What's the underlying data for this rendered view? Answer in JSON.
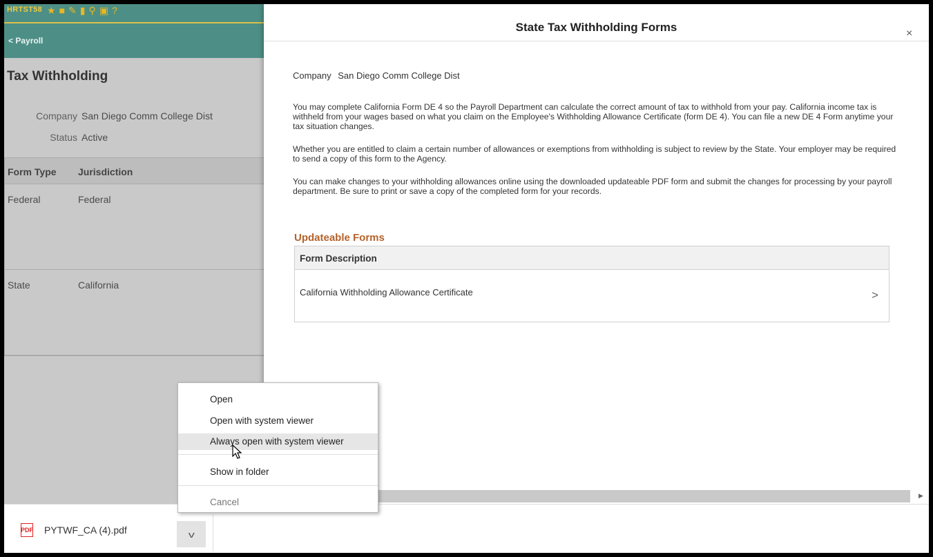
{
  "left_pane": {
    "app_code": "HRTST58",
    "toolbar_icons": [
      "star-icon",
      "folder-icon",
      "pencil-icon",
      "document-icon",
      "search-icon",
      "folder-search-icon",
      "help-icon"
    ],
    "back_label": "< Payroll",
    "title": "Tax Withholding",
    "company_label": "Company",
    "company_value": "San Diego Comm College Dist",
    "status_label": "Status",
    "status_value": "Active",
    "grid": {
      "columns": [
        "Form Type",
        "Jurisdiction"
      ],
      "rows": [
        [
          "Federal",
          "Federal"
        ],
        [
          "State",
          "California"
        ]
      ]
    }
  },
  "modal": {
    "title": "State Tax Withholding Forms",
    "close_label": "×",
    "company_label": "Company",
    "company_value": "San Diego Comm College Dist",
    "paragraphs": [
      "You may complete California Form DE 4 so the Payroll Department can calculate the correct amount of tax to withhold from your pay.  California income tax is withheld from your wages based on what you claim on the Employee's Withholding Allowance Certificate (form DE 4).  You can file a new DE 4 Form anytime your tax situation changes.",
      "Whether you are entitled to claim a certain number of allowances or exemptions from withholding is subject to review by the State. Your employer may be required to send a copy of this form to the Agency.",
      "You can make changes to your withholding allowances online using the downloaded updateable PDF form and submit the changes for processing by your payroll department.  Be sure to print or save a copy of the completed form for your records."
    ],
    "updateable_forms": {
      "title": "Updateable Forms",
      "header": "Form Description",
      "rows": [
        "California Withholding Allowance Certificate"
      ],
      "chevron": ">"
    }
  },
  "download_bar": {
    "filename": "PYTWF_CA (4).pdf",
    "pdf_icon_text": "PDF",
    "chevron": "v"
  },
  "context_menu": {
    "items": [
      "Open",
      "Open with system viewer",
      "Always open with system viewer",
      "Show in folder",
      "Cancel"
    ],
    "hovered_item": "Always open with system viewer",
    "disabled_item": "Cancel"
  }
}
